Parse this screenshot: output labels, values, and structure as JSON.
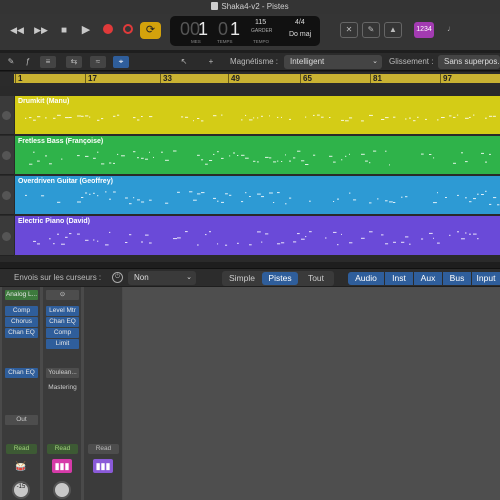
{
  "window": {
    "title": "Shaka4-v2 - Pistes"
  },
  "lcd": {
    "bar": "1",
    "beat": "1",
    "bar_label": "MES",
    "beat_label": "TEMPS",
    "tempo": "115",
    "tempo_mode": "GARDER",
    "tempo_label": "TEMPO",
    "signature": "4/4",
    "key": "Do maj"
  },
  "count_in": "1234",
  "toolbar": {
    "magnetism_label": "Magnétisme :",
    "magnetism_value": "Intelligent",
    "drag_label": "Glissement :",
    "drag_value": "Sans superpos..."
  },
  "ruler": {
    "ticks": [
      "1",
      "17",
      "33",
      "49",
      "65",
      "81",
      "97"
    ]
  },
  "tracks": [
    {
      "name": "Drumkit (Manu)",
      "color": "#d4cc16"
    },
    {
      "name": "Fretless Bass (Françoise)",
      "color": "#2fb34a"
    },
    {
      "name": "Overdriven Guitar (Geoffrey)",
      "color": "#2d9ad4"
    },
    {
      "name": "Electric Piano (David)",
      "color": "#6a4ad8"
    }
  ],
  "mixer_bar": {
    "sends_label": "Envois sur les curseurs :",
    "sends_value": "Non",
    "views": [
      "Simple",
      "Pistes",
      "Tout"
    ],
    "active_view": "Pistes",
    "filters": [
      "Audio",
      "Inst",
      "Aux",
      "Bus",
      "Input"
    ]
  },
  "strips": [
    {
      "input": "Analog L...",
      "plugins": [
        "Comp",
        "Chorus",
        "Chan EQ"
      ],
      "sends": [
        "Chan EQ"
      ],
      "output": "Out",
      "automation": "Read",
      "pan": "-15"
    },
    {
      "plugins": [
        "Level Mtr",
        "Chan EQ",
        "Comp",
        "Limit"
      ],
      "sends": [
        "Youlean..."
      ],
      "output": "Mastering",
      "automation": "Read"
    },
    {
      "automation": "Read"
    }
  ]
}
